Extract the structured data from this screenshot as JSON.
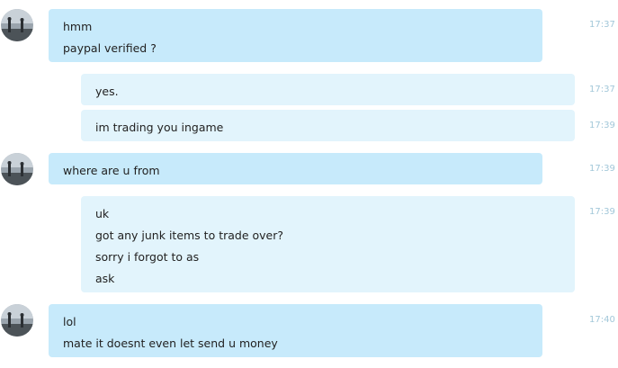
{
  "messages": [
    {
      "direction": "incoming",
      "lines": [
        "hmm",
        "paypal verified ?"
      ],
      "time": "17:37",
      "avatar": "user-photo-avatar"
    },
    {
      "direction": "outgoing",
      "lines": [
        "yes."
      ],
      "time": "17:37"
    },
    {
      "direction": "outgoing",
      "lines": [
        "im trading you ingame"
      ],
      "time": "17:39"
    },
    {
      "direction": "incoming",
      "lines": [
        "where are u from"
      ],
      "time": "17:39",
      "avatar": "user-photo-avatar"
    },
    {
      "direction": "outgoing",
      "lines": [
        "uk",
        "got any junk items to trade over?",
        "sorry i forgot to as",
        "ask"
      ],
      "time": "17:39"
    },
    {
      "direction": "incoming",
      "lines": [
        "lol",
        "mate it doesnt even let send u money"
      ],
      "time": "17:40",
      "avatar": "user-photo-avatar"
    }
  ],
  "colors": {
    "incoming_bubble": "#c7eafb",
    "outgoing_bubble": "#e2f4fc",
    "timestamp": "#a2c7d9",
    "text": "#222222"
  }
}
